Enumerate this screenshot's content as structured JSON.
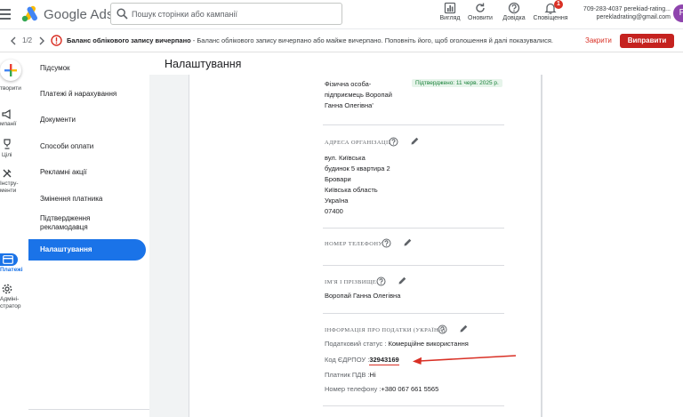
{
  "header": {
    "logo_text": "Google Ads",
    "search_placeholder": "Пошук сторінки або кампанії",
    "tools": [
      {
        "label": "Вигляд",
        "icon": "view-icon"
      },
      {
        "label": "Оновити",
        "icon": "refresh-icon"
      },
      {
        "label": "Довідка",
        "icon": "help-icon"
      },
      {
        "label": "Сповіщення",
        "icon": "bell-icon"
      }
    ],
    "notif_count": "1",
    "account_id": "709-283-4037 perekiad-rating...",
    "account_email": "perekladrating@gmail.com",
    "avatar_letter": "P"
  },
  "notice": {
    "counter": "1/2",
    "title": "Баланс облікового запису вичерпано",
    "text": " - Баланс облікового запису вичерпано або майже вичерпано. Поповніть його, щоб оголошення й далі показувалися.",
    "close_label": "Закрити",
    "fix_label": "Виправити"
  },
  "rail": {
    "items": [
      {
        "label": "творити",
        "icon": "create-plus-icon"
      },
      {
        "label": "мпанії",
        "icon": "campaigns-icon"
      },
      {
        "label": "Цілі",
        "icon": "goals-icon"
      },
      {
        "label": "Інстру-\nменти",
        "icon": "tools-icon"
      },
      {
        "label": "Платежі",
        "icon": "billing-icon"
      },
      {
        "label": "Адміні-\nстратор",
        "icon": "admin-icon"
      }
    ]
  },
  "subnav": {
    "items": [
      {
        "label": "Підсумок"
      },
      {
        "label": "Платежі й нарахування"
      },
      {
        "label": "Документи"
      },
      {
        "label": "Способи оплати"
      },
      {
        "label": "Рекламні акції"
      },
      {
        "label": "Змінення платника"
      },
      {
        "label": "Підтвердження рекламодавця"
      },
      {
        "label": "Налаштування"
      }
    ]
  },
  "main": {
    "page_title": "Налаштування",
    "entity": {
      "line1": "Фізична особа-",
      "line2": "підприємець Воропай",
      "line3": "Ганна Олегівна'",
      "badge": "Підтверджено: 11 черв. 2025 р."
    },
    "address": {
      "title": "Адреса організації",
      "lines": [
        "вул. Київська",
        "будинок 5 квартира 2",
        "Бровари",
        "Київська область",
        "Україна",
        "07400"
      ]
    },
    "phone": {
      "title": "Номер телефону"
    },
    "name": {
      "title": "Ім'я і прізвище",
      "value": "Воропай Ганна Олегівна"
    },
    "tax": {
      "title": "Інформація про податки (Україна)",
      "status_label": "Податковий статус :",
      "status_value": "Комерційне використання",
      "edrpou_label": "Код ЄДРПОУ :",
      "edrpou_value": "32943169",
      "vat_label": "Платник ПДВ :",
      "vat_value": "Ні",
      "phone_label": "Номер телефону :",
      "phone_value": "+380  067 661 5565"
    }
  },
  "colors": {
    "accent": "#1a73e8",
    "error": "#d93025",
    "fix_button": "#c5221f",
    "verified": "#188038",
    "arrow": "#d93025"
  }
}
